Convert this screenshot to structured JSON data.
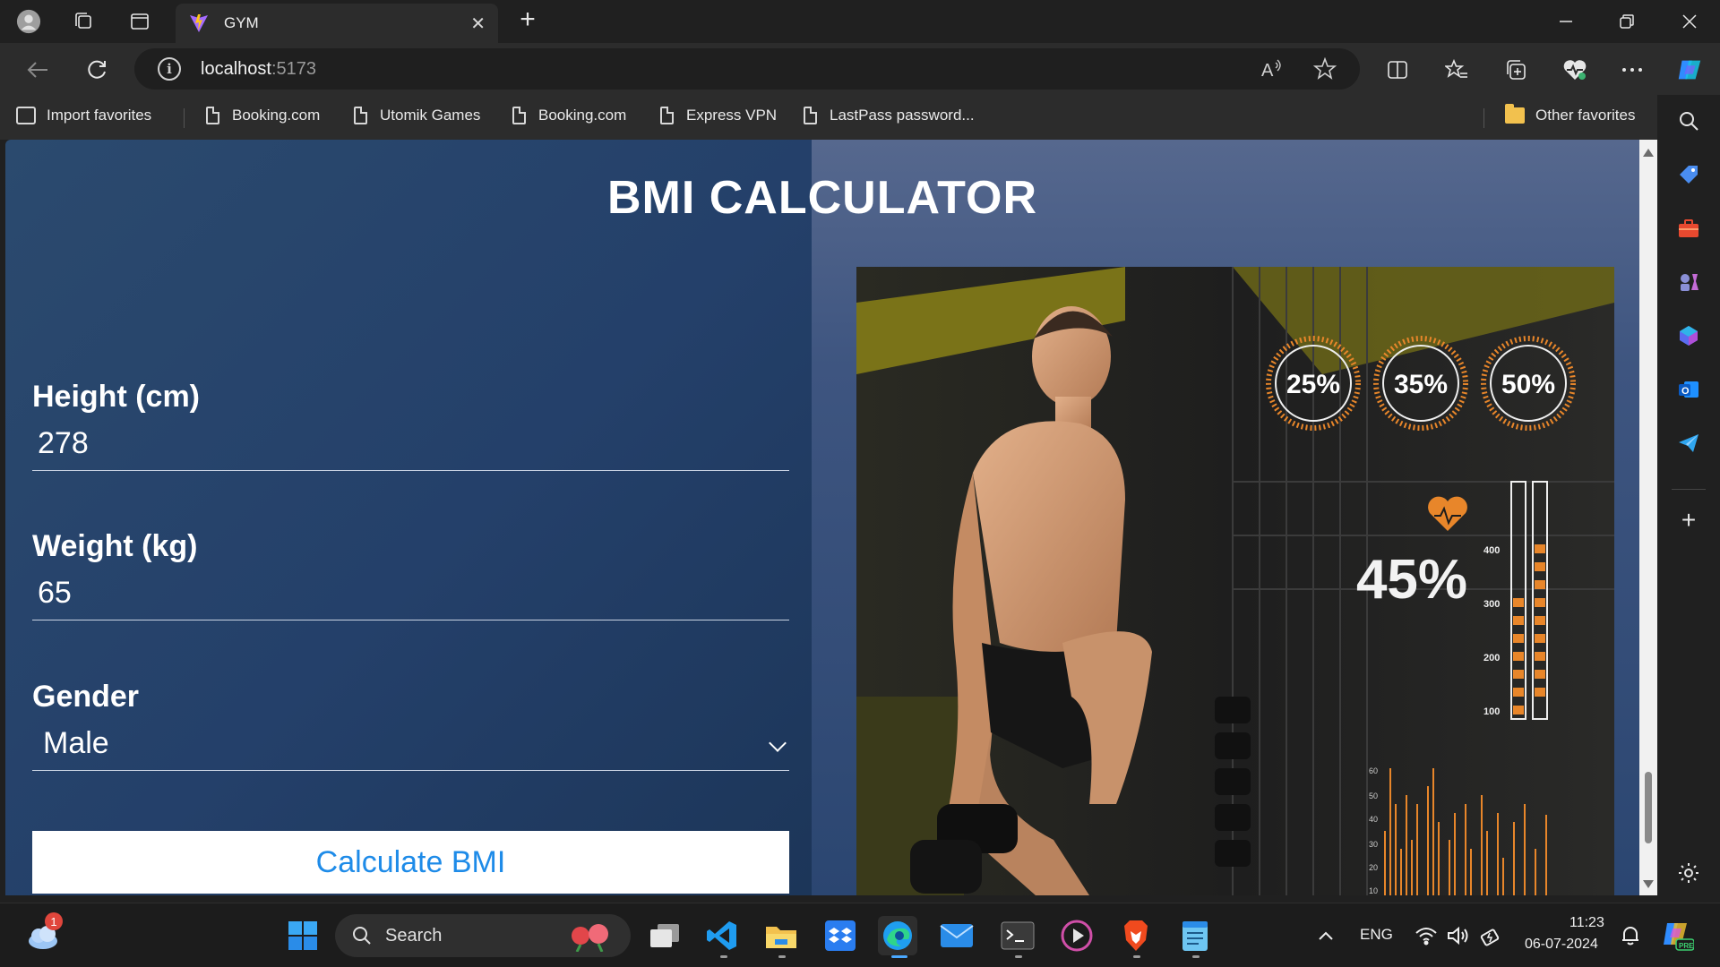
{
  "browser": {
    "tab_title": "GYM",
    "close_tab": "✕",
    "new_tab": "+",
    "url_host": "localhost",
    "url_port": ":5173"
  },
  "favorites": [
    {
      "label": "Import favorites",
      "icon": "import-icon"
    },
    {
      "label": "Booking.com",
      "icon": "page-icon"
    },
    {
      "label": "Utomik Games",
      "icon": "page-icon"
    },
    {
      "label": "Booking.com",
      "icon": "page-icon"
    },
    {
      "label": "Express VPN",
      "icon": "page-icon"
    },
    {
      "label": "LastPass password...",
      "icon": "page-icon"
    }
  ],
  "other_favorites": "Other favorites",
  "page": {
    "title": "BMI CALCULATOR",
    "height_label": "Height (cm)",
    "height_value": "278",
    "weight_label": "Weight (kg)",
    "weight_value": "65",
    "gender_label": "Gender",
    "gender_value": "Male",
    "gender_options": [
      "Male"
    ],
    "button_label": "Calculate BMI"
  },
  "hero_overlay": {
    "rings": [
      "25%",
      "35%",
      "50%"
    ],
    "big_percent": "45%",
    "scale_ticks": [
      "400",
      "300",
      "200",
      "100"
    ],
    "histogram_ticks": [
      "60",
      "50",
      "40",
      "30",
      "20",
      "10"
    ]
  },
  "taskbar": {
    "search_placeholder": "Search",
    "notification_count": "1",
    "language": "ENG",
    "time": "11:23",
    "date": "06-07-2024"
  },
  "colors": {
    "accent_blue": "#1e8be8",
    "hud_orange": "#e8862a",
    "page_bg": "#24406a"
  }
}
